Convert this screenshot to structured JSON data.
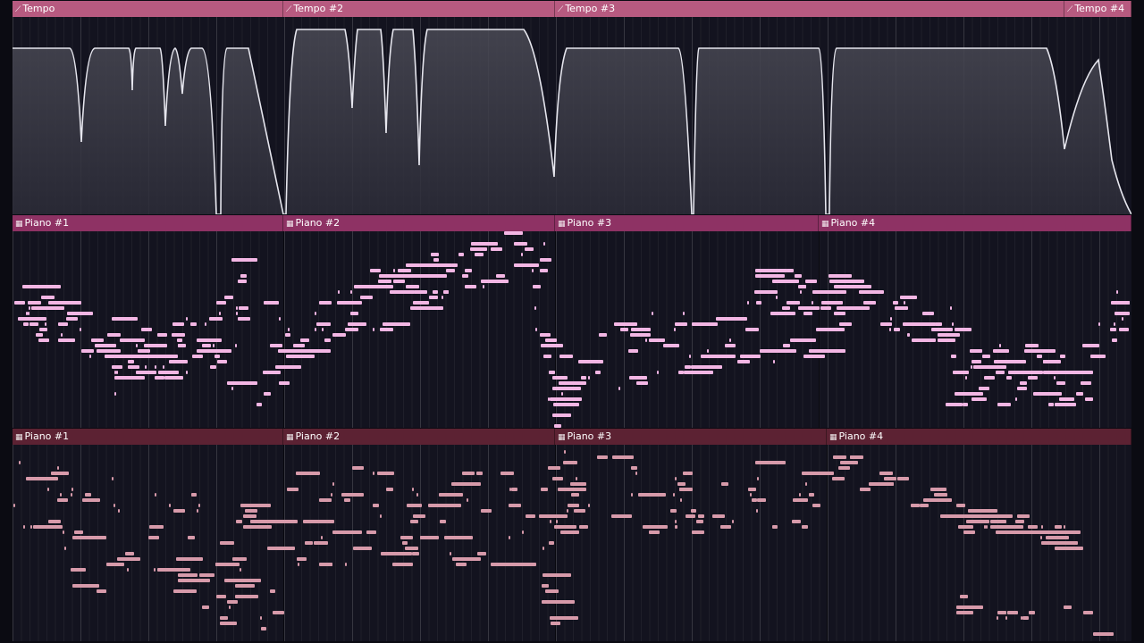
{
  "colors": {
    "tempo_header": "#b75a80",
    "piano_top_header": "#8e3264",
    "piano_bottom_header": "#5c2233",
    "tempo_curve": "#e6e6ee",
    "note_top": "#f3b6e4",
    "note_bottom": "#d79aaa",
    "background": "#13131f"
  },
  "tracks": {
    "tempo": {
      "clips": [
        {
          "label": "Tempo",
          "icon": "automation-icon"
        },
        {
          "label": "Tempo #2",
          "icon": "automation-icon"
        },
        {
          "label": "Tempo #3",
          "icon": "automation-icon"
        },
        {
          "label": "Tempo #4",
          "icon": "automation-icon"
        }
      ]
    },
    "piano_top": {
      "clips": [
        {
          "label": "Piano #1",
          "icon": "pattern-icon"
        },
        {
          "label": "Piano #2",
          "icon": "pattern-icon"
        },
        {
          "label": "Piano #3",
          "icon": "pattern-icon"
        },
        {
          "label": "Piano #4",
          "icon": "pattern-icon"
        }
      ]
    },
    "piano_bottom": {
      "clips": [
        {
          "label": "Piano #1",
          "icon": "pattern-icon"
        },
        {
          "label": "Piano #2",
          "icon": "pattern-icon"
        },
        {
          "label": "Piano #3",
          "icon": "pattern-icon"
        },
        {
          "label": "Piano #4",
          "icon": "pattern-icon"
        }
      ]
    }
  }
}
